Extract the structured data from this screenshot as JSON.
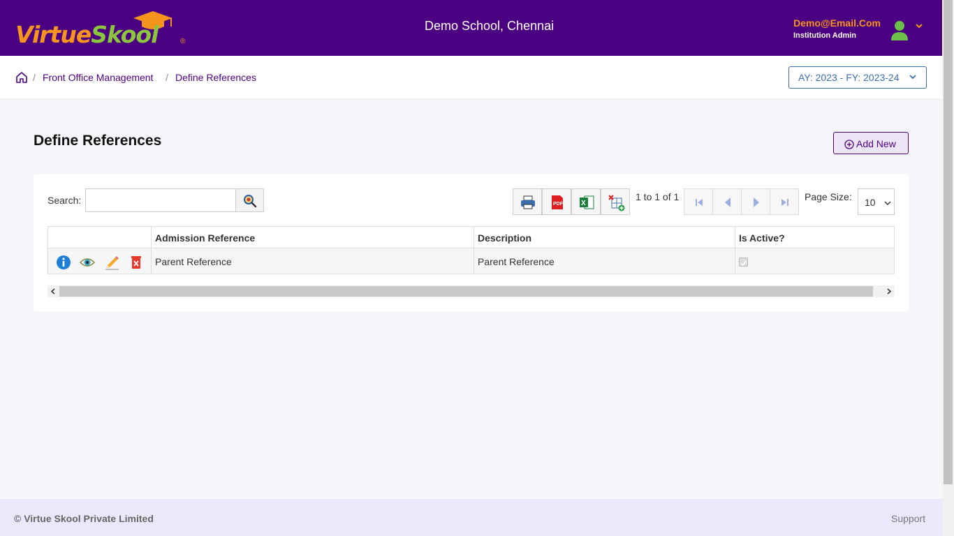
{
  "header": {
    "logo_part1": "Virtue",
    "logo_part2": "Skool",
    "logo_reg": "®",
    "school_name": "Demo School, Chennai",
    "user_email": "Demo@Email.Com",
    "user_role": "Institution Admin"
  },
  "breadcrumb": {
    "items": [
      "Front Office Management",
      "Define References"
    ],
    "separator": "/"
  },
  "year_selector": {
    "value": "AY: 2023 - FY: 2023-24"
  },
  "page": {
    "title": "Define References",
    "add_new_label": "Add New"
  },
  "search": {
    "label": "Search:",
    "value": "",
    "placeholder": ""
  },
  "toolbar": {
    "print_icon": "printer-icon",
    "pdf_icon": "pdf-icon",
    "excel_icon": "excel-icon",
    "import_icon": "grid-add-icon"
  },
  "pagination": {
    "info": "1 to 1 of 1",
    "page_size_label": "Page Size:",
    "page_size": "10"
  },
  "table": {
    "columns": [
      "",
      "Admission Reference",
      "Description",
      "Is Active?"
    ],
    "rows": [
      {
        "admission_reference": "Parent Reference",
        "description": "Parent Reference",
        "is_active": true
      }
    ]
  },
  "footer": {
    "copyright": "© Virtue Skool Private Limited",
    "support": "Support"
  },
  "colors": {
    "header_bg": "#4b0082",
    "logo_orange": "#f7941d",
    "logo_green": "#8cc63f",
    "footer_bg": "#ece8fb"
  }
}
